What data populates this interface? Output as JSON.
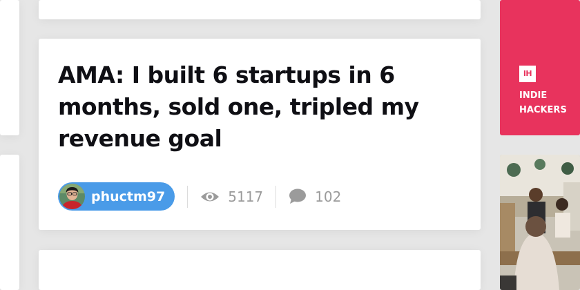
{
  "post": {
    "title": "AMA: I built 6 startups in 6 months, sold one, tripled my revenue goal",
    "author": "phuctm97",
    "views": "5117",
    "comments": "102"
  },
  "brand": {
    "logo_text": "IH",
    "name": "INDIE HACKERS",
    "accent_color": "#e8335d"
  },
  "icons": {
    "views": "eye-icon",
    "comments": "speech-bubble-icon"
  }
}
